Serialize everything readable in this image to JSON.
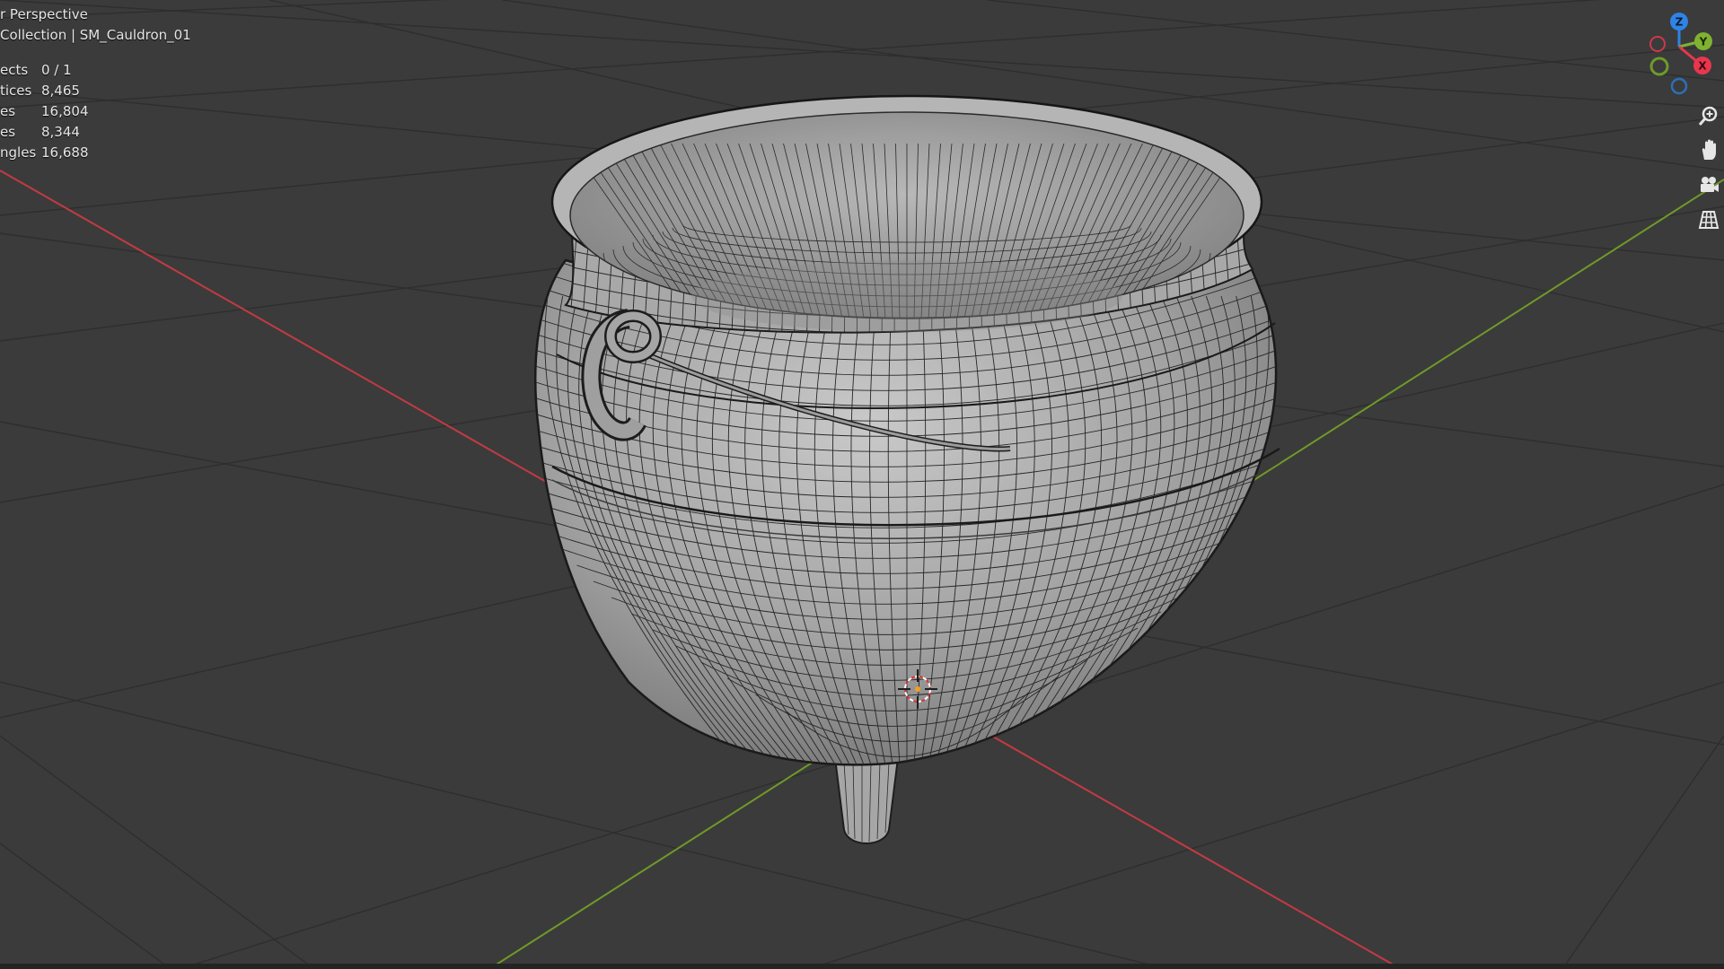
{
  "viewport": {
    "view_title": "r Perspective",
    "collection_path": "Collection | SM_Cauldron_01"
  },
  "stats": [
    {
      "label": "ects",
      "value": "0 / 1"
    },
    {
      "label": "tices",
      "value": "8,465"
    },
    {
      "label": "es",
      "value": "16,804"
    },
    {
      "label": "es",
      "value": "8,344"
    },
    {
      "label": "ngles",
      "value": "16,688"
    }
  ],
  "gizmo": {
    "axes": [
      {
        "name": "Z",
        "color": "#2f83e6"
      },
      {
        "name": "Y",
        "color": "#7fb231"
      },
      {
        "name": "X",
        "color": "#e8364e"
      }
    ],
    "negative_axis_colors": [
      "#c83a4a",
      "#6e9a2a",
      "#2c6fb8"
    ]
  },
  "nav_buttons": [
    {
      "name": "zoom",
      "icon": "zoom-icon"
    },
    {
      "name": "pan",
      "icon": "hand-icon"
    },
    {
      "name": "camera",
      "icon": "camera-icon"
    },
    {
      "name": "orthographic",
      "icon": "grid-icon"
    }
  ],
  "colors": {
    "background": "#3b3b3b",
    "grid_line": "#2f2f2f",
    "x_axis": "#c43a43",
    "y_axis": "#6f9a28",
    "mesh_fill": "#9a9a9a",
    "wire": "#1e1e1e"
  }
}
